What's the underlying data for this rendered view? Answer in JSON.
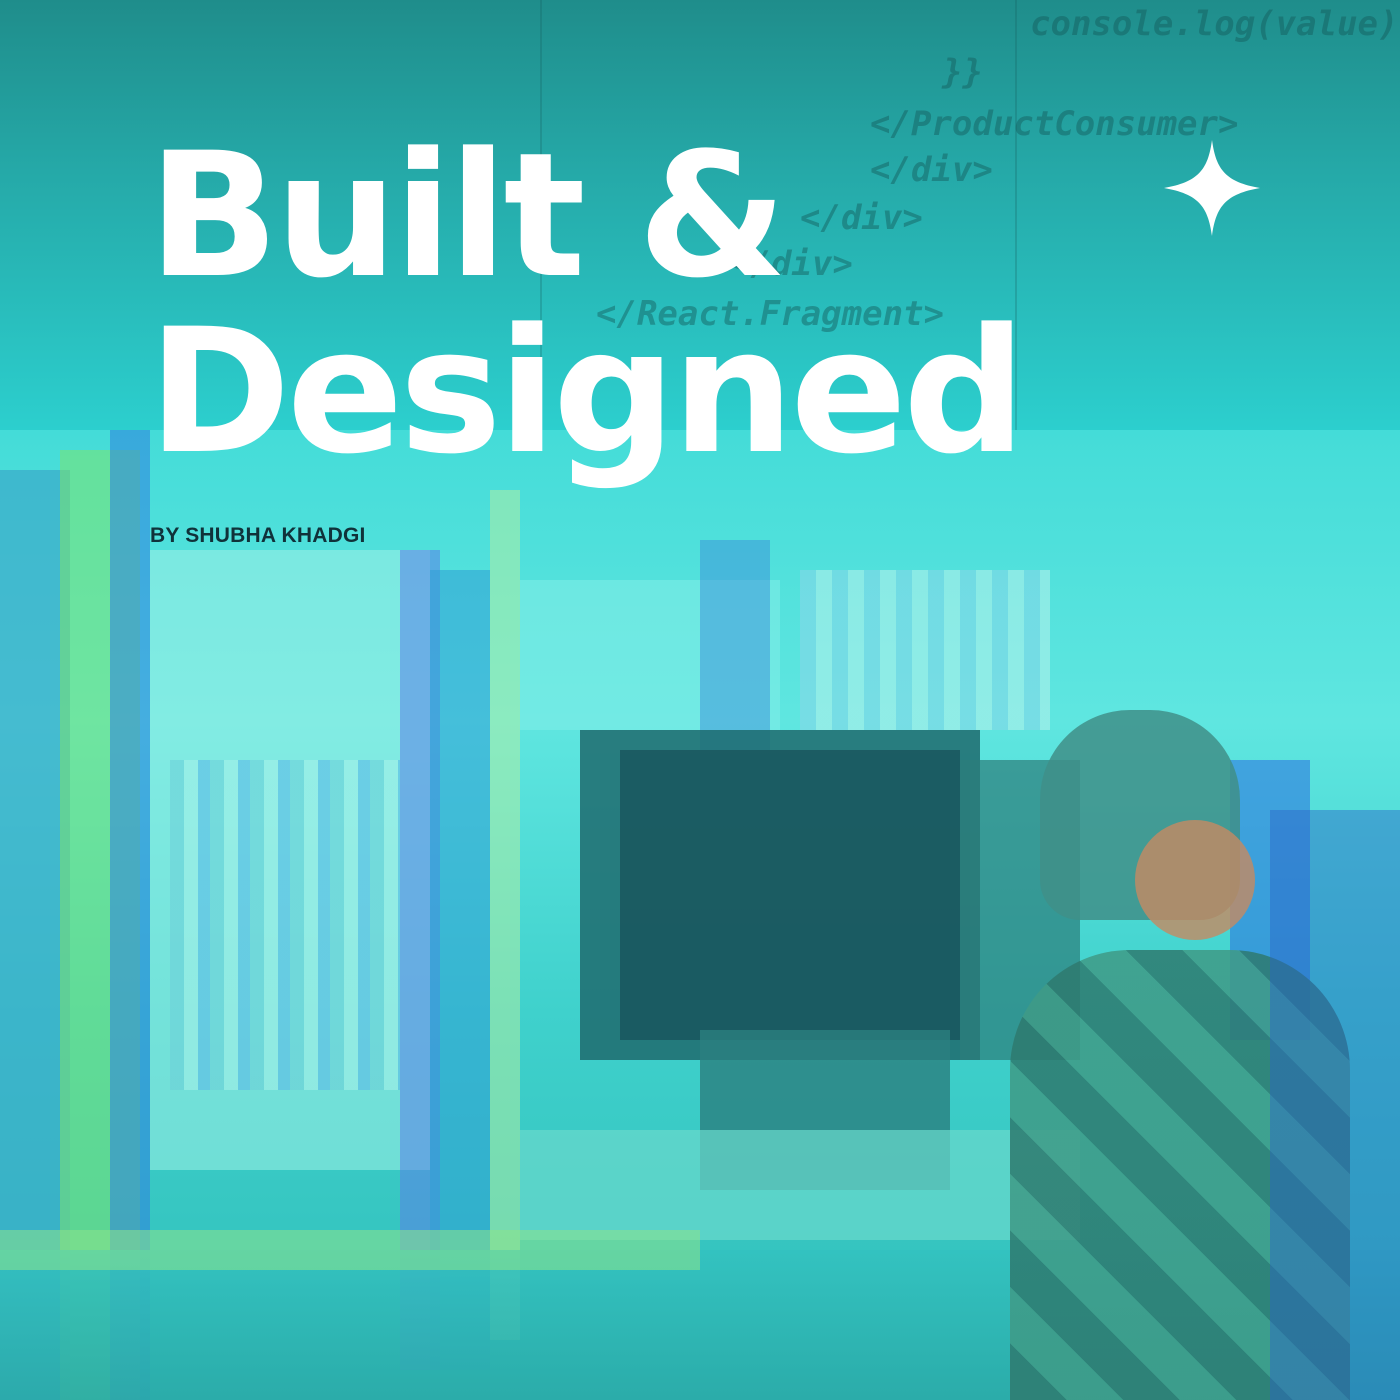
{
  "cover": {
    "title_line_1": "Built &",
    "title_line_2": "Designed",
    "byline": "BY SHUBHA KHADGI"
  },
  "background_code": {
    "lines": [
      "console.log(value)",
      "}}",
      "</ProductConsumer>",
      "</div>",
      "</div>",
      "</div>",
      "</React.Fragment>"
    ]
  },
  "icons": {
    "sparkle": "sparkle-icon"
  },
  "colors": {
    "title": "#ffffff",
    "byline": "#10323a",
    "teal_dark": "#1f8d8b",
    "teal_light": "#5fe6e0"
  }
}
